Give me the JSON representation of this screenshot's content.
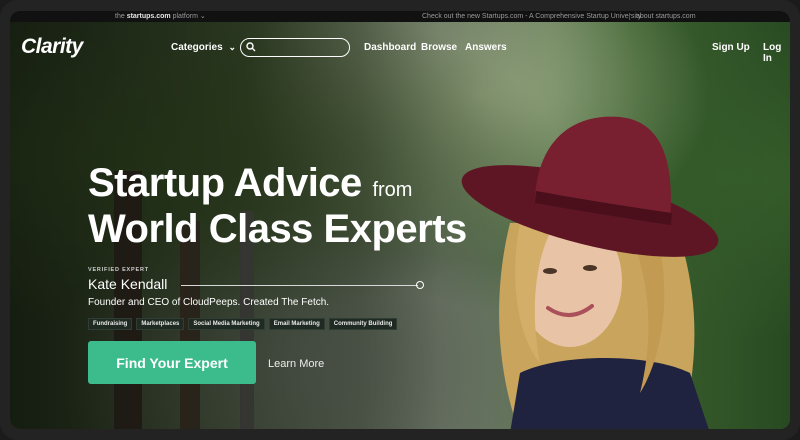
{
  "topbar": {
    "platform_prefix": "the",
    "platform_name": "startups.com",
    "platform_suffix": "platform",
    "promo": "Check out the new Startups.com - A Comprehensive Startup University",
    "about": "about startups.com"
  },
  "nav": {
    "logo": "Clarity",
    "categories": "Categories",
    "search_placeholder": "",
    "dashboard": "Dashboard",
    "browse": "Browse",
    "answers": "Answers",
    "signup": "Sign Up",
    "login": "Log In"
  },
  "hero": {
    "line1": "Startup Advice",
    "line1_suffix": "from",
    "line2": "World Class Experts",
    "verified_label": "VERIFIED EXPERT",
    "expert_name": "Kate Kendall",
    "expert_title": "Founder and CEO of CloudPeeps. Created The Fetch.",
    "tags": [
      "Fundraising",
      "Marketplaces",
      "Social Media Marketing",
      "Email Marketing",
      "Community Building"
    ],
    "cta": "Find Your Expert",
    "learn_more": "Learn More"
  },
  "colors": {
    "accent": "#3cbc8d",
    "hat": "#6e1b2b"
  }
}
